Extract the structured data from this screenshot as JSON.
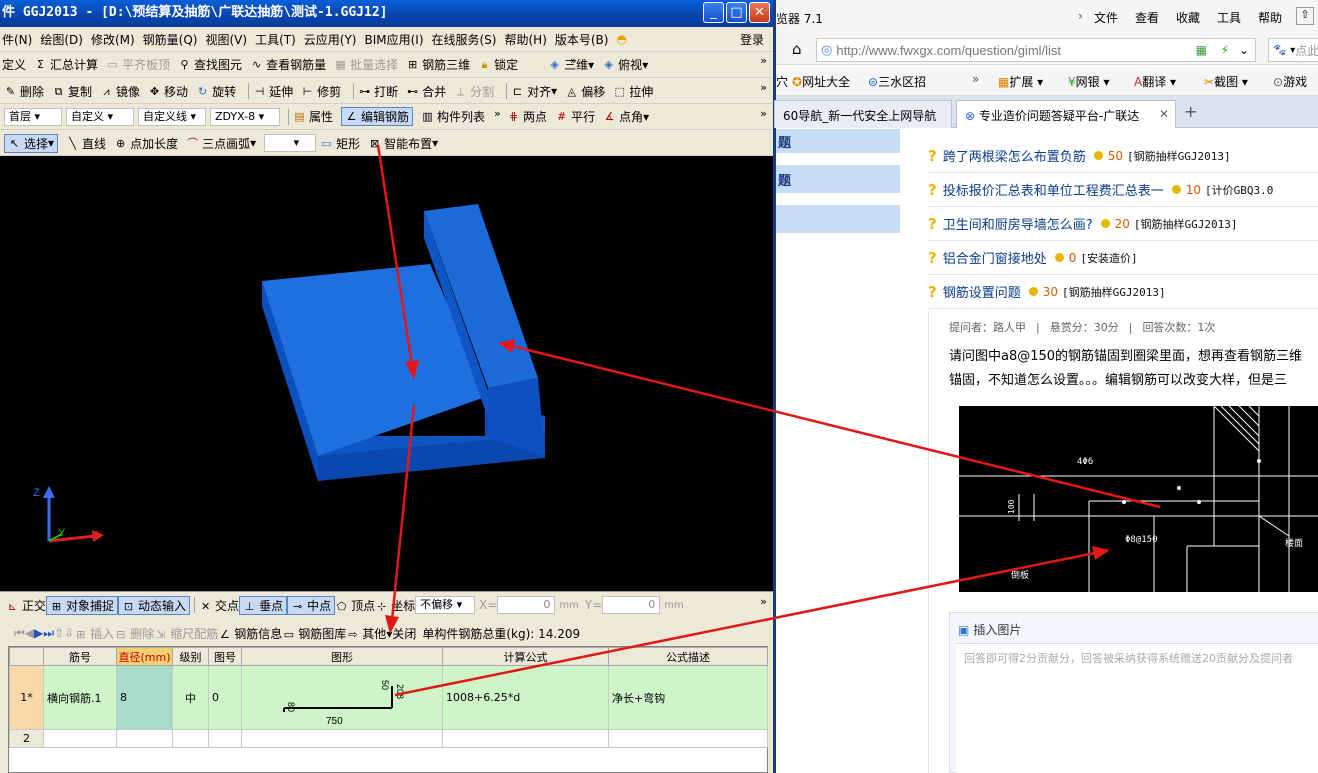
{
  "app": {
    "title": "件 GGJ2013 - [D:\\预结算及抽筋\\广联达抽筋\\测试-1.GGJ12]",
    "menu": [
      "件(N)",
      "绘图(D)",
      "修改(M)",
      "钢筋量(Q)",
      "视图(V)",
      "工具(T)",
      "云应用(Y)",
      "BIM应用(I)",
      "在线服务(S)",
      "帮助(H)",
      "版本号(B)"
    ],
    "login": "登录",
    "toolbar1": [
      "定义",
      "汇总计算",
      "平齐板顶",
      "查找图元",
      "查看钢筋量",
      "批量选择",
      "钢筋三维",
      "锁定",
      "三维",
      "俯视"
    ],
    "toolbar2": [
      "删除",
      "复制",
      "镜像",
      "移动",
      "旋转",
      "延伸",
      "修剪",
      "打断",
      "合并",
      "分割",
      "对齐",
      "偏移",
      "拉伸"
    ],
    "toolbar3": {
      "floor": "首层",
      "type": "自定义",
      "line": "自定义线",
      "code": "ZDYX-8",
      "attr": "属性",
      "edit_rebar": "编辑钢筋",
      "component_list": "构件列表",
      "two_points": "两点",
      "parallel": "平行",
      "point_angle": "点角"
    },
    "toolbar4": {
      "select": "选择",
      "line": "直线",
      "point_len": "点加长度",
      "arc": "三点画弧",
      "rect": "矩形",
      "smart": "智能布置"
    },
    "axes": {
      "z": "Z",
      "y": "Y",
      "x": "X"
    },
    "snapbar": {
      "ortho": "正交",
      "snap": "对象捕捉",
      "dyn": "动态输入",
      "intersect": "交点",
      "perp": "垂点",
      "mid": "中点",
      "vertex": "顶点",
      "coord": "坐标",
      "offset": "不偏移",
      "x_label": "X=",
      "x_val": "0",
      "mm1": "mm",
      "y_label": "Y=",
      "y_val": "0",
      "mm2": "mm"
    },
    "gridbar": {
      "insert": "插入",
      "delete": "删除",
      "scale": "缩尺配筋",
      "rebar_info": "钢筋信息",
      "rebar_lib": "钢筋图库",
      "other": "其他",
      "close": "关闭",
      "total": "单构件钢筋总重(kg): 14.209"
    },
    "table": {
      "headers": [
        "筋号",
        "直径(mm)",
        "级别",
        "图号",
        "图形",
        "计算公式",
        "公式描述"
      ],
      "rows": [
        {
          "idx": "1*",
          "name": "横向钢筋.1",
          "dia": "8",
          "grade": "中",
          "fig": "0",
          "formula": "1008+6.25*d",
          "desc": "净长+弯钩"
        },
        {
          "idx": "2",
          "name": "",
          "dia": "",
          "grade": "",
          "fig": "",
          "formula": "",
          "desc": ""
        }
      ],
      "shape": {
        "len": "750",
        "h1": "50",
        "h2": "208",
        "h3": "80"
      }
    }
  },
  "browser": {
    "title": "览器 7.1",
    "menu": [
      "文件",
      "查看",
      "收藏",
      "工具",
      "帮助"
    ],
    "url": "http://www.fwxgx.com/question/giml/list",
    "search_placeholder": "点此",
    "favs": [
      "网址大全",
      "三水区招",
      "扩展",
      "网银",
      "翻译",
      "截图",
      "游戏"
    ],
    "tabs": [
      "60导航_新一代安全上网导航",
      "专业造价问题答疑平台-广联达"
    ],
    "side_items": [
      "题",
      "题",
      ""
    ],
    "questions": [
      {
        "text": "跨了两根梁怎么布置负筋",
        "score": "50",
        "cat": "[钢筋抽样GGJ2013]"
      },
      {
        "text": "投标报价汇总表和单位工程费汇总表一",
        "score": "10",
        "cat": "[计价GBQ3.0"
      },
      {
        "text": "卫生间和厨房导墙怎么画?",
        "score": "20",
        "cat": "[钢筋抽样GGJ2013]"
      },
      {
        "text": "铝合金门窗接地处",
        "score": "0",
        "cat": "[安装造价]"
      },
      {
        "text": "钢筋设置问题",
        "score": "30",
        "cat": "[钢筋抽样GGJ2013]"
      }
    ],
    "meta": {
      "asker": "提问者：路人甲",
      "sep1": "|",
      "reward": "悬赏分：30分",
      "sep2": "|",
      "answers": "回答次数：1次"
    },
    "body1": "请问图中a8@150的钢筋锚固到圈梁里面，想再查看钢筋三维",
    "body2": "锚固，不知道怎么设置。。。编辑钢筋可以改变大样，但是三",
    "cad": {
      "t1": "4Φ6",
      "t2": "Φ8@150",
      "t3": "100",
      "t4": "楼面",
      "t5": "倒板"
    },
    "insert_pic": "插入图片",
    "reply_placeholder": "回答即可得2分贡献分，回答被采纳获得系统赠送20贡献分及提问者"
  }
}
